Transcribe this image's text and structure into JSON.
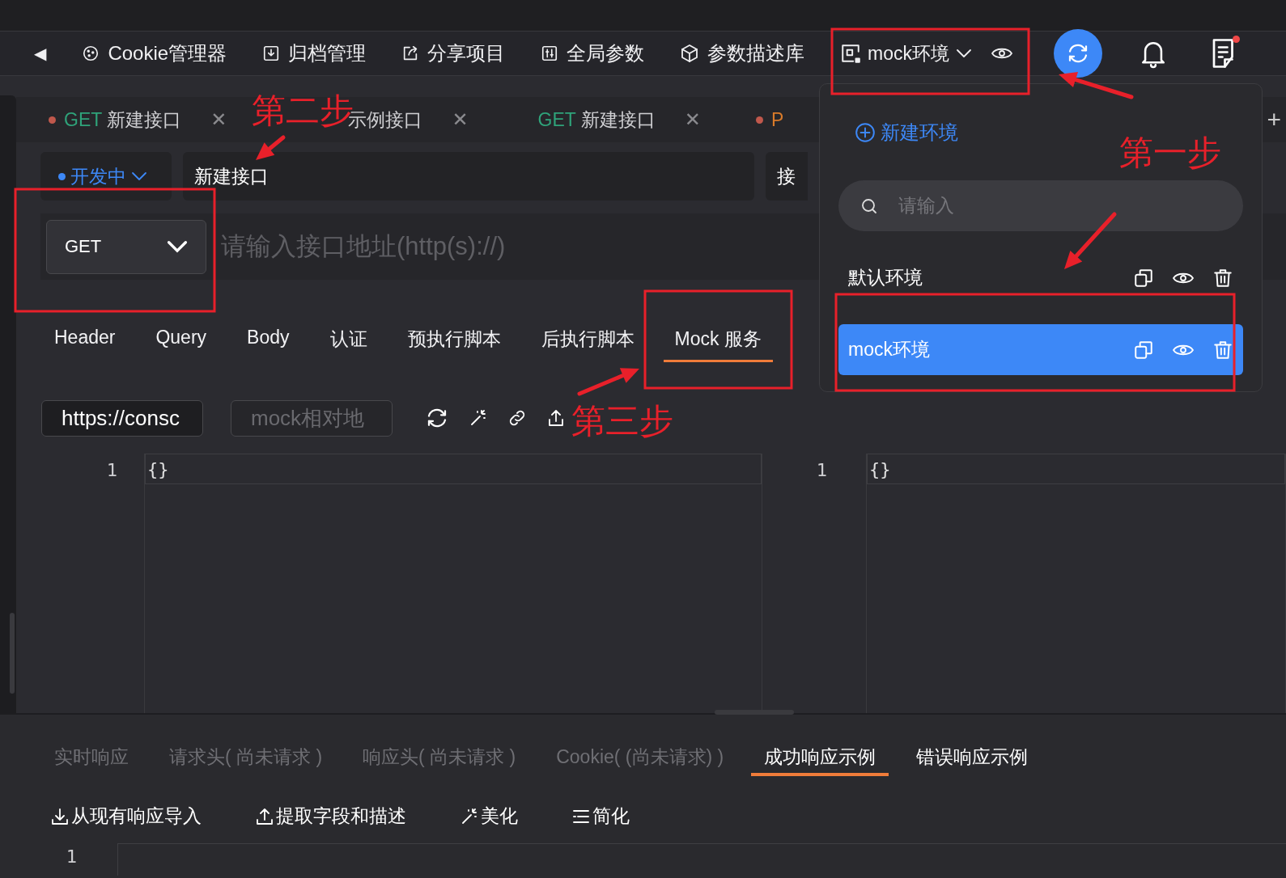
{
  "toolbar": {
    "items": [
      {
        "kind": "back",
        "label": "◀"
      },
      {
        "kind": "cookie",
        "label": "Cookie管理器"
      },
      {
        "kind": "archive",
        "label": "归档管理"
      },
      {
        "kind": "share",
        "label": "分享项目"
      },
      {
        "kind": "params",
        "label": "全局参数"
      },
      {
        "kind": "cube",
        "label": "参数描述库"
      }
    ],
    "environment": {
      "label": "mock环境"
    },
    "notes": {
      "unread": true
    }
  },
  "request_tabs": [
    {
      "method": "GET",
      "color": "#2fa37a",
      "title": "新建接口",
      "modified": true,
      "close": "✕"
    },
    {
      "title": "示例接口",
      "modified": false,
      "close": "✕"
    },
    {
      "method": "GET",
      "color": "#2fa37a",
      "title": "新建接口",
      "modified": false,
      "close": "✕"
    },
    {
      "method": "P",
      "color": "#d97b2a",
      "modified": true
    }
  ],
  "add_tab": "+",
  "request": {
    "status": "开发中",
    "name": "新建接口",
    "side_field": "接",
    "method": "GET",
    "url_placeholder": "请输入接口地址(http(s)://)"
  },
  "param_tabs": [
    {
      "label": "Header",
      "selected": false
    },
    {
      "label": "Query",
      "selected": false
    },
    {
      "label": "Body",
      "selected": false
    },
    {
      "label": "认证",
      "selected": false
    },
    {
      "label": "预执行脚本",
      "selected": false
    },
    {
      "label": "后执行脚本",
      "selected": false
    },
    {
      "label": "Mock 服务",
      "selected": true
    }
  ],
  "mock": {
    "base_url": "https://consc",
    "path_placeholder": "mock相对地",
    "editors": [
      {
        "line": "1",
        "code": "{}"
      },
      {
        "line": "1",
        "code": "{}"
      }
    ]
  },
  "response_tabs": [
    {
      "label": "实时响应",
      "selected": false,
      "disabled": true
    },
    {
      "label": "请求头( 尚未请求 )",
      "selected": false,
      "disabled": true
    },
    {
      "label": "响应头( 尚未请求 )",
      "selected": false,
      "disabled": true
    },
    {
      "label": "Cookie( (尚未请求) )",
      "selected": false,
      "disabled": true
    },
    {
      "label": "成功响应示例",
      "selected": true,
      "disabled": false
    },
    {
      "label": "错误响应示例",
      "selected": false,
      "disabled": false
    }
  ],
  "response_actions": [
    {
      "kind": "import",
      "label": "从现有响应导入"
    },
    {
      "kind": "extract",
      "label": "提取字段和描述"
    },
    {
      "kind": "beautify",
      "label": "美化"
    },
    {
      "kind": "simplify",
      "label": "简化"
    }
  ],
  "response_editor": {
    "line": "1"
  },
  "env_menu": {
    "new_label": "新建环境",
    "search_placeholder": "请输入",
    "environments": [
      {
        "name": "默认环境",
        "selected": false
      },
      {
        "name": "mock环境",
        "selected": true
      }
    ]
  },
  "annotations": [
    "第一步",
    "第二步",
    "第三步"
  ]
}
